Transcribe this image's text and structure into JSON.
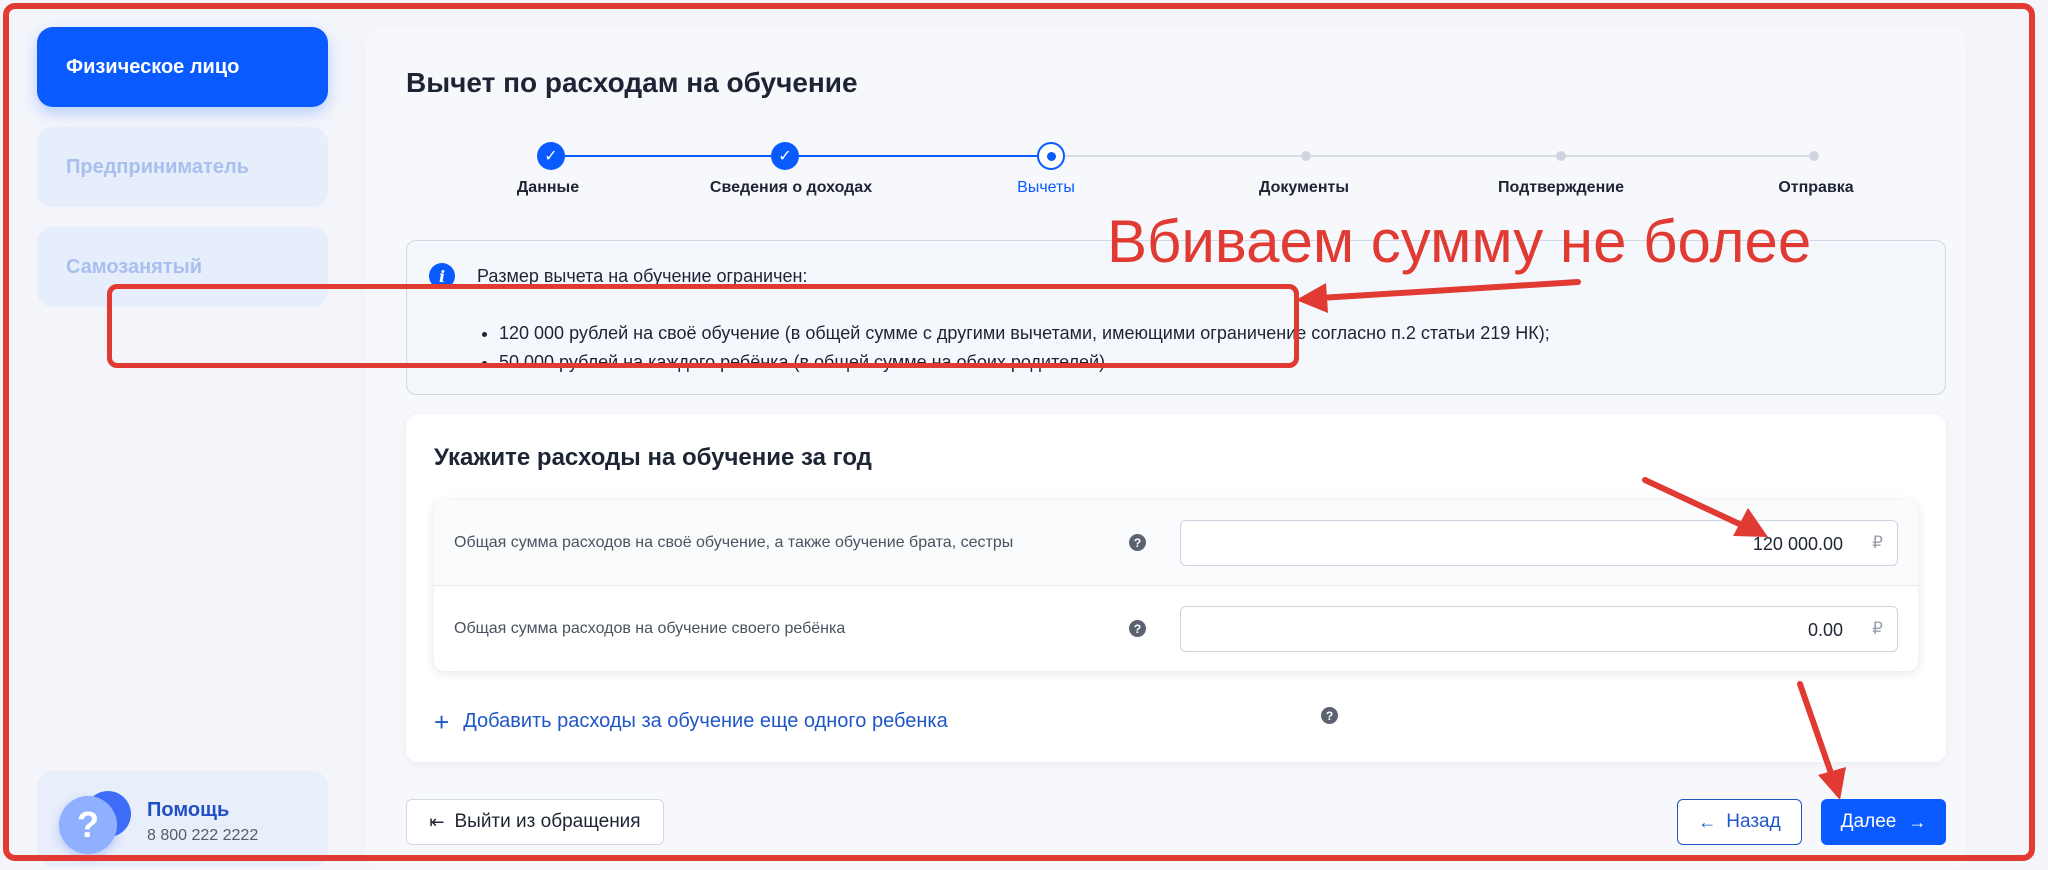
{
  "sidebar": {
    "items": [
      {
        "label": "Физическое лицо"
      },
      {
        "label": "Предприниматель"
      },
      {
        "label": "Самозанятый"
      }
    ],
    "help": {
      "title": "Помощь",
      "phone": "8 800 222 2222",
      "icon": "?"
    }
  },
  "main": {
    "title": "Вычет по расходам на обучение",
    "steps": [
      {
        "label": "Данные",
        "state": "done"
      },
      {
        "label": "Сведения о доходах",
        "state": "done"
      },
      {
        "label": "Вычеты",
        "state": "current"
      },
      {
        "label": "Документы",
        "state": "todo"
      },
      {
        "label": "Подтверждение",
        "state": "todo"
      },
      {
        "label": "Отправка",
        "state": "todo"
      }
    ],
    "annotation": "Вбиваем сумму не более",
    "info": {
      "title": "Размер вычета на обучение ограничен:",
      "items": [
        "120 000 рублей на своё обучение (в общей сумме с другими вычетами, имеющими ограничение согласно п.2 статьи 219 НК);",
        "50 000 рублей на каждого ребёнка (в общей сумме на обоих родителей)."
      ]
    },
    "expenses": {
      "title": "Укажите расходы на обучение за год",
      "rows": [
        {
          "label": "Общая сумма расходов на своё обучение, а также обучение брата, сестры",
          "value": "120 000.00",
          "currency": "₽"
        },
        {
          "label": "Общая сумма расходов на обучение своего ребёнка",
          "value": "0.00",
          "currency": "₽"
        }
      ],
      "add_label": "Добавить расходы за обучение еще одного ребенка"
    },
    "buttons": {
      "exit": "Выйти из обращения",
      "back": "Назад",
      "next": "Далее"
    }
  },
  "colors": {
    "accent": "#0a5bff",
    "annotation": "#e03a32"
  }
}
